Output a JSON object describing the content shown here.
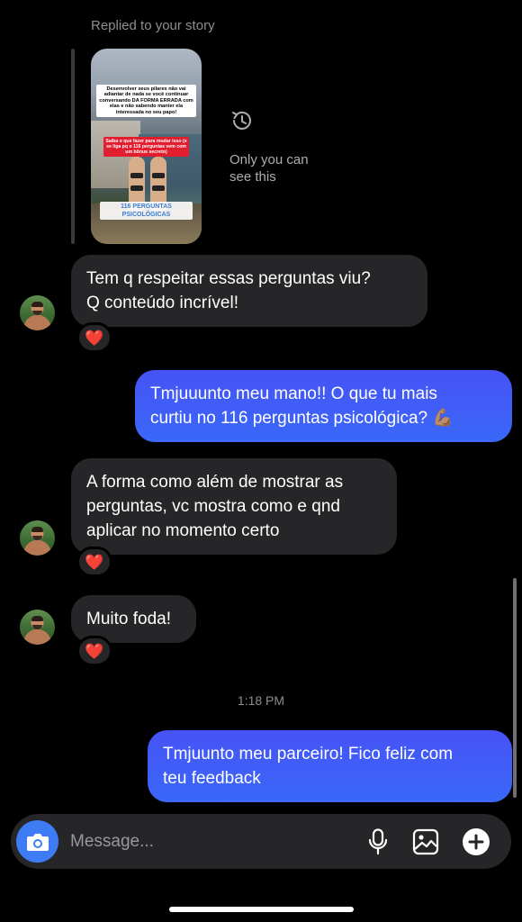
{
  "story_reply": {
    "label": "Replied to your story",
    "thumbnail": {
      "headline": "Desenvolver seus pilares não vai adiantar de nada se você continuar conversando DA FORMA ERRADA com elas e não sabendo manter ela interessada no seu papo!",
      "red_banner": "Saiba o que fazer para mudar isso (e se liga pq o 116 perguntas vem com um bônus secreto)",
      "blue_banner": "116 PERGUNTAS PSICOLÓGICAS"
    },
    "status_icon": "clock-history-icon",
    "status_text": "Only you can see this"
  },
  "messages": [
    {
      "direction": "incoming",
      "lines": [
        "Tem q respeitar essas perguntas viu?",
        "Q conteúdo incrível!"
      ],
      "reaction": "❤️"
    },
    {
      "direction": "outgoing",
      "lines": [
        "Tmjuuunto meu mano!! O que tu mais",
        "curtiu no 116 perguntas psicológica? 💪🏽"
      ]
    },
    {
      "direction": "incoming",
      "lines": [
        "A forma como além de mostrar as",
        "perguntas, vc mostra como e qnd",
        "aplicar no momento certo"
      ],
      "reaction": "❤️"
    },
    {
      "direction": "incoming",
      "lines": [
        "Muito foda!"
      ],
      "reaction": "❤️"
    },
    {
      "direction": "outgoing",
      "lines": [
        "Tmjuunto meu parceiro! Fico feliz com",
        "teu feedback"
      ]
    }
  ],
  "timestamp": "1:18 PM",
  "composer": {
    "placeholder": "Message...",
    "camera_icon": "camera-icon",
    "mic_icon": "microphone-icon",
    "gallery_icon": "image-gallery-icon",
    "add_icon": "plus-circle-icon"
  },
  "colors": {
    "outgoing_bubble": "#3d5afe",
    "incoming_bubble": "#262628",
    "camera_button": "#3d7cf4",
    "heart": "#e8132a"
  }
}
